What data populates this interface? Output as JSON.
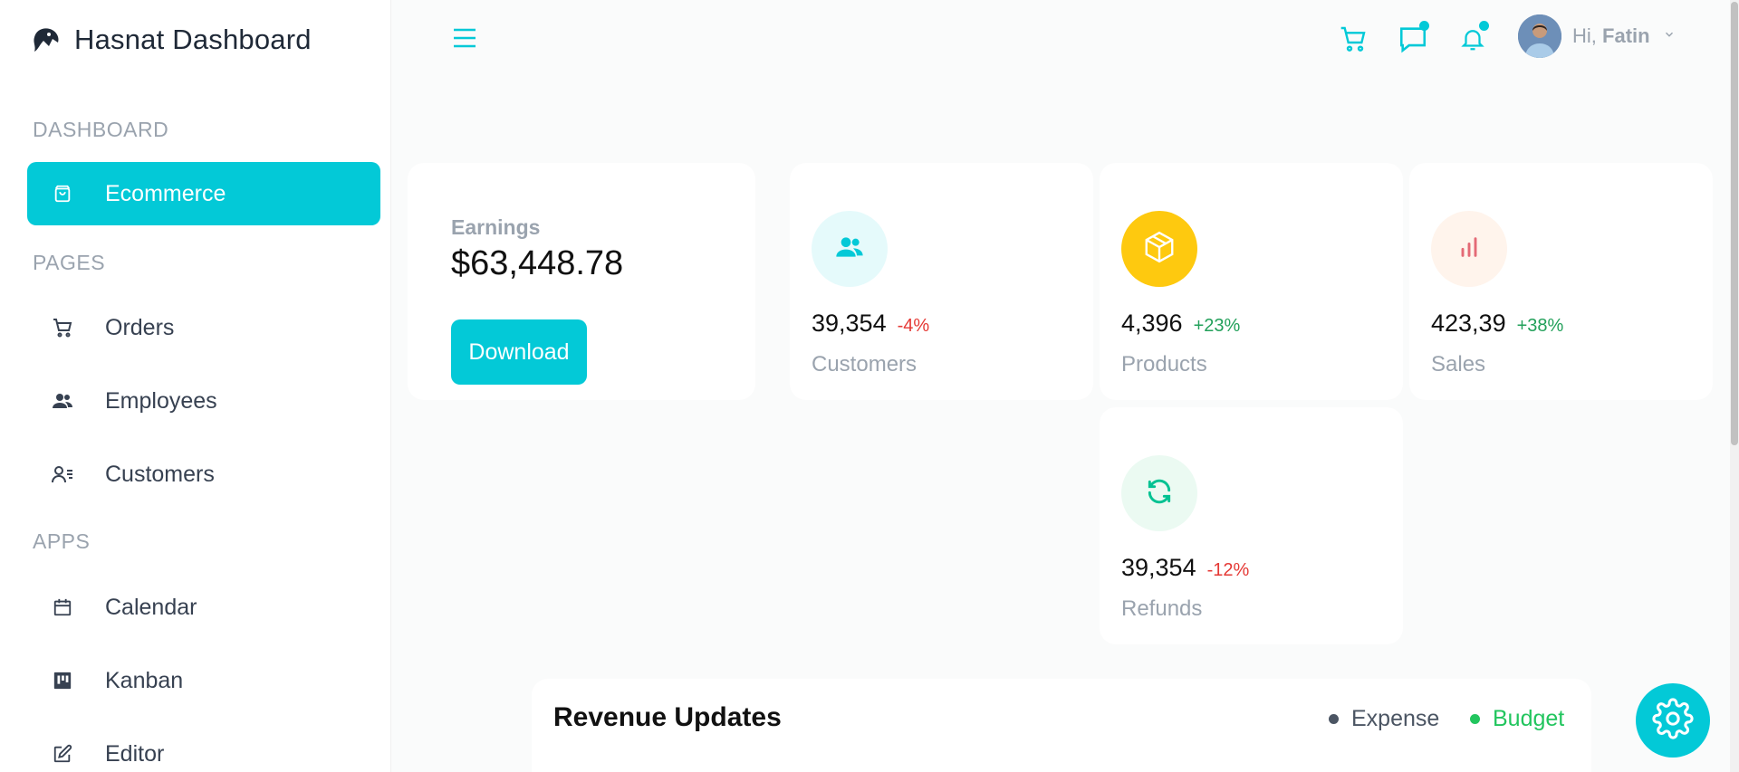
{
  "app": {
    "title": "Hasnat Dashboard"
  },
  "sidebar": {
    "sections": [
      {
        "label": "DASHBOARD",
        "items": [
          {
            "label": "Ecommerce",
            "icon": "shopping-bag-icon",
            "active": true
          }
        ]
      },
      {
        "label": "PAGES",
        "items": [
          {
            "label": "Orders",
            "icon": "cart-icon"
          },
          {
            "label": "Employees",
            "icon": "users-icon"
          },
          {
            "label": "Customers",
            "icon": "customer-list-icon"
          }
        ]
      },
      {
        "label": "APPS",
        "items": [
          {
            "label": "Calendar",
            "icon": "calendar-icon"
          },
          {
            "label": "Kanban",
            "icon": "kanban-icon"
          },
          {
            "label": "Editor",
            "icon": "edit-icon"
          }
        ]
      }
    ]
  },
  "header": {
    "icons": [
      "cart-icon",
      "chat-icon",
      "bell-icon"
    ],
    "user": {
      "greeting": "Hi,",
      "name": "Fatin"
    }
  },
  "earnings": {
    "label": "Earnings",
    "value": "$63,448.78",
    "button": "Download"
  },
  "stats": [
    {
      "value": "39,354",
      "change": "-4%",
      "trend": "neg",
      "label": "Customers",
      "icon": "users-icon",
      "icon_color": "#03c9d7",
      "icon_bg": "#e5fafb"
    },
    {
      "value": "4,396",
      "change": "+23%",
      "trend": "pos",
      "label": "Products",
      "icon": "box-icon",
      "icon_color": "#ffffff",
      "icon_bg": "#fec90f"
    },
    {
      "value": "423,39",
      "change": "+38%",
      "trend": "pos",
      "label": "Sales",
      "icon": "bar-chart-icon",
      "icon_color": "#e46a76",
      "icon_bg": "#fff4ec"
    },
    {
      "value": "39,354",
      "change": "-12%",
      "trend": "neg",
      "label": "Refunds",
      "icon": "refresh-icon",
      "icon_color": "#00c292",
      "icon_bg": "#ebfaf2"
    }
  ],
  "revenue": {
    "title": "Revenue Updates",
    "legend": [
      {
        "label": "Expense",
        "color": "#4b5563"
      },
      {
        "label": "Budget",
        "color": "#22c55e"
      }
    ]
  },
  "colors": {
    "accent": "#03c9d7",
    "negative": "#e53935",
    "positive": "#22a05a"
  }
}
